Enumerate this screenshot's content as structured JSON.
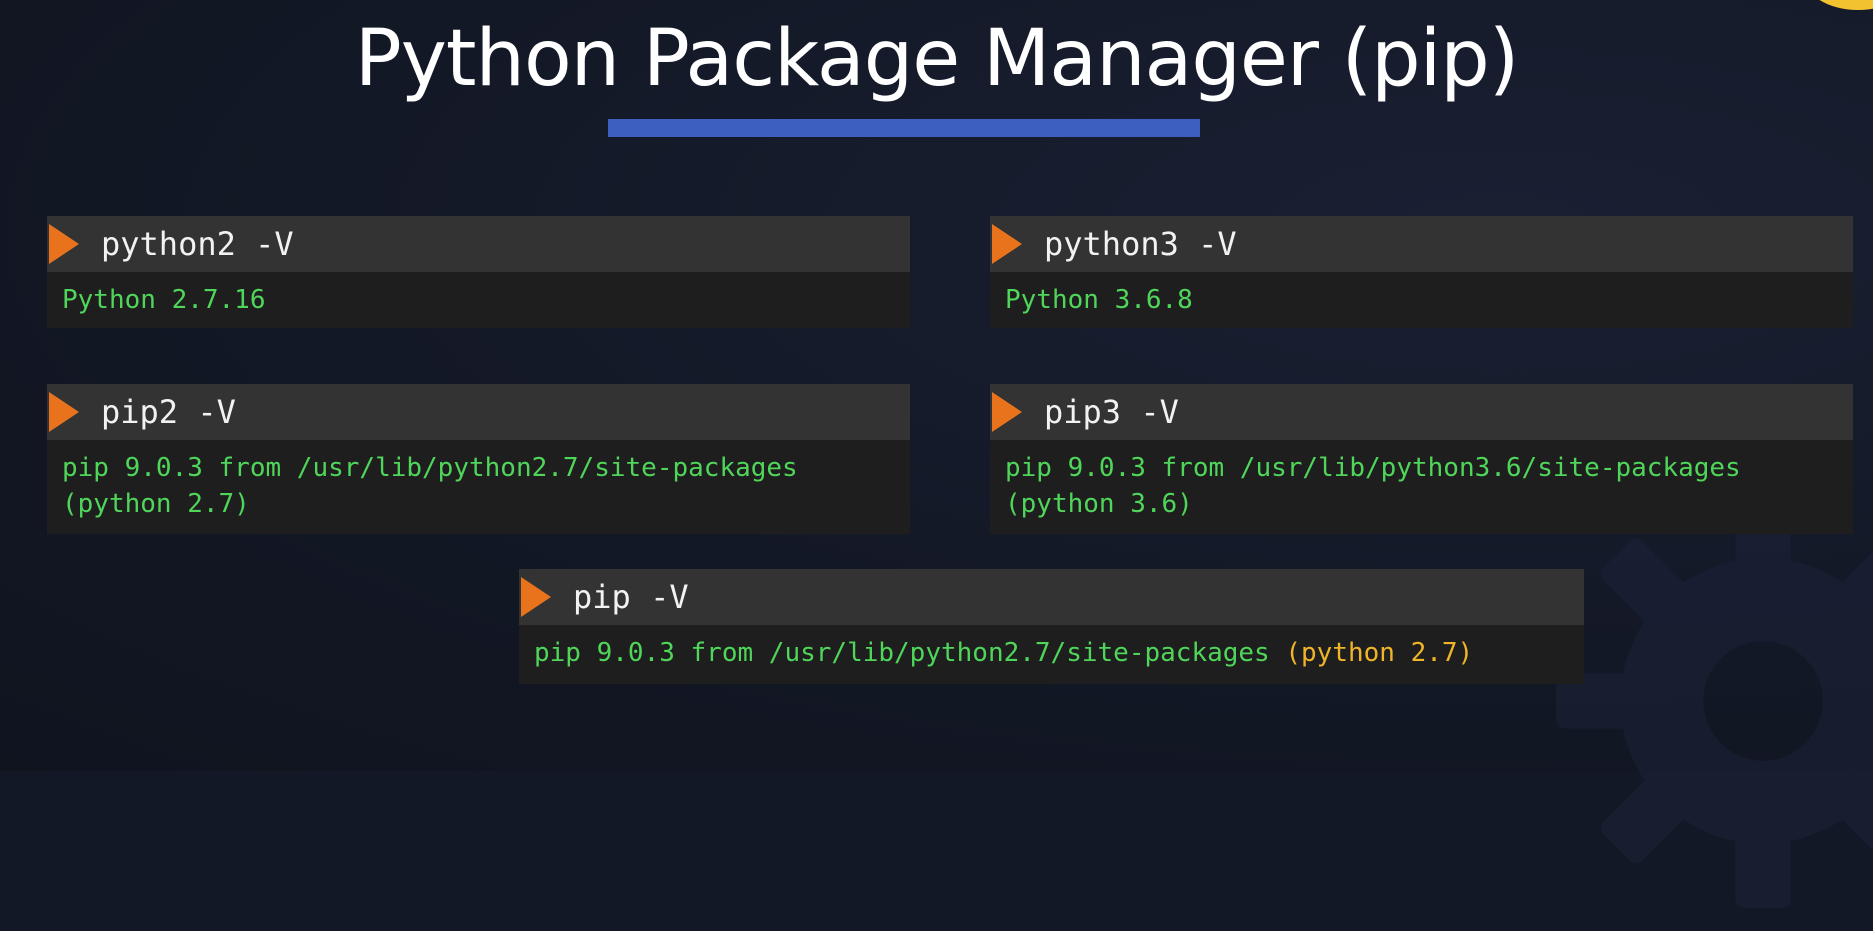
{
  "slide": {
    "title": "Python Package Manager (pip)",
    "accent_color": "#3d5fc0",
    "prompt_color": "#e8731c",
    "output_color": "#4fd65a",
    "highlight_color": "#f0b429"
  },
  "terminals": {
    "python2": {
      "command": "python2 -V",
      "output": [
        "Python 2.7.16"
      ]
    },
    "python3": {
      "command": "python3 -V",
      "output": [
        "Python 3.6.8"
      ]
    },
    "pip2": {
      "command": "pip2 -V",
      "output": [
        "pip 9.0.3 from /usr/lib/python2.7/site-packages",
        "(python 2.7)"
      ]
    },
    "pip3": {
      "command": "pip3 -V",
      "output": [
        "pip 9.0.3 from /usr/lib/python3.6/site-packages",
        "(python 3.6)"
      ]
    },
    "pip": {
      "command": "pip -V",
      "output_main": "pip 9.0.3 from /usr/lib/python2.7/site-packages ",
      "output_highlight": "(python 2.7)"
    }
  },
  "icons": {
    "prompt": "play-arrow-icon",
    "background": "gear-icon"
  }
}
